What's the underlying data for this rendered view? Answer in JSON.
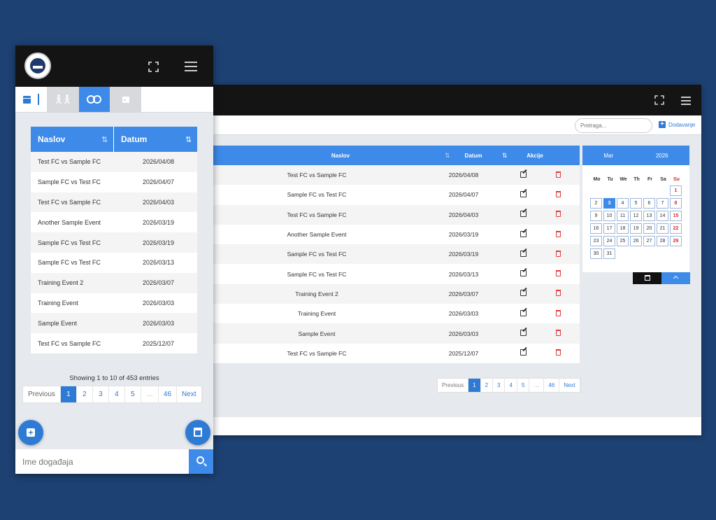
{
  "desktop": {
    "search_placeholder": "Pretraga...",
    "add_label": "Dodavanje",
    "table": {
      "headers": {
        "title": "Naslov",
        "date": "Datum",
        "actions": "Akcije"
      },
      "rows": [
        {
          "title": "Test FC vs Sample FC",
          "date": "2026/04/08"
        },
        {
          "title": "Sample FC vs Test FC",
          "date": "2026/04/07"
        },
        {
          "title": "Test FC vs Sample FC",
          "date": "2026/04/03"
        },
        {
          "title": "Another Sample Event",
          "date": "2026/03/19"
        },
        {
          "title": "Sample FC vs Test FC",
          "date": "2026/03/19"
        },
        {
          "title": "Sample FC vs Test FC",
          "date": "2026/03/13"
        },
        {
          "title": "Training Event 2",
          "date": "2026/03/07"
        },
        {
          "title": "Training Event",
          "date": "2026/03/03"
        },
        {
          "title": "Sample Event",
          "date": "2026/03/03"
        },
        {
          "title": "Test FC vs Sample FC",
          "date": "2025/12/07"
        }
      ]
    },
    "pager": [
      "Previous",
      "1",
      "2",
      "3",
      "4",
      "5",
      "…",
      "46",
      "Next"
    ],
    "calendar": {
      "month": "Mar",
      "year": "2026",
      "weekdays": [
        "Mo",
        "Tu",
        "We",
        "Th",
        "Fr",
        "Sa",
        "Su"
      ],
      "days": [
        "",
        "",
        "",
        "",
        "",
        "",
        "1",
        "2",
        "3",
        "4",
        "5",
        "6",
        "7",
        "8",
        "9",
        "10",
        "11",
        "12",
        "13",
        "14",
        "15",
        "16",
        "17",
        "18",
        "19",
        "20",
        "21",
        "22",
        "23",
        "24",
        "25",
        "26",
        "27",
        "28",
        "29",
        "30",
        "31"
      ],
      "today": "3",
      "accent": "#3d8ae8"
    }
  },
  "mobile": {
    "tabs": [
      "calendar-icon",
      "players-icon",
      "rings-icon",
      "schedule-icon"
    ],
    "table": {
      "headers": {
        "title": "Naslov",
        "date": "Datum"
      },
      "rows": [
        {
          "title": "Test FC vs Sample FC",
          "date": "2026/04/08"
        },
        {
          "title": "Sample FC vs Test FC",
          "date": "2026/04/07"
        },
        {
          "title": "Test FC vs Sample FC",
          "date": "2026/04/03"
        },
        {
          "title": "Another Sample Event",
          "date": "2026/03/19"
        },
        {
          "title": "Sample FC vs Test FC",
          "date": "2026/03/19"
        },
        {
          "title": "Sample FC vs Test FC",
          "date": "2026/03/13"
        },
        {
          "title": "Training Event 2",
          "date": "2026/03/07"
        },
        {
          "title": "Training Event",
          "date": "2026/03/03"
        },
        {
          "title": "Sample Event",
          "date": "2026/03/03"
        },
        {
          "title": "Test FC vs Sample FC",
          "date": "2025/12/07"
        }
      ]
    },
    "showing": "Showing 1 to 10 of 453 entries",
    "pager": [
      "Previous",
      "1",
      "2",
      "3",
      "4",
      "5",
      "…",
      "46",
      "Next"
    ],
    "search_placeholder": "Ime događaja"
  },
  "colors": {
    "background": "#1e4173",
    "primary": "#3d8ae8",
    "danger": "#e23a3a",
    "topbar": "#141414"
  }
}
